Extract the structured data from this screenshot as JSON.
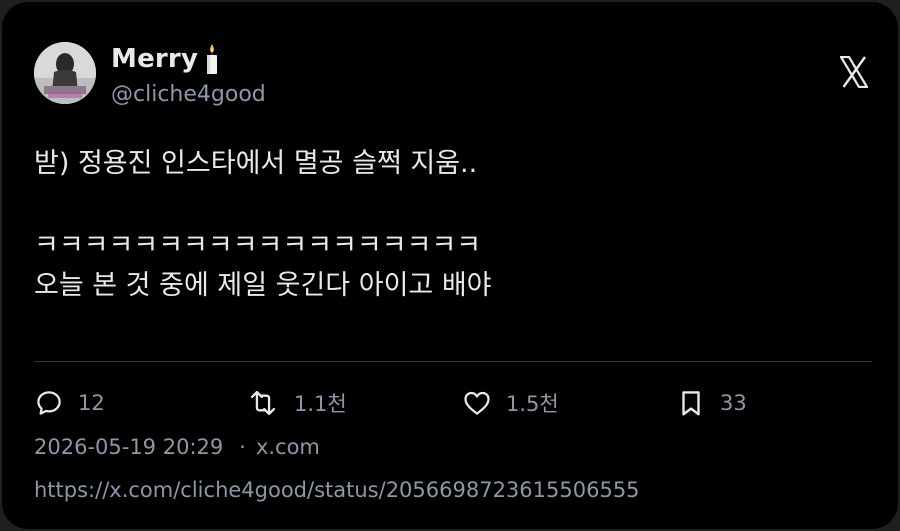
{
  "author": {
    "display_name": "Merry",
    "handle": "@cliche4good",
    "name_emoji": "candle-icon"
  },
  "tweet": {
    "lines": [
      "받) 정용진 인스타에서 멸공 슬쩍 지움..",
      "",
      "ㅋㅋㅋㅋㅋㅋㅋㅋㅋㅋㅋㅋㅋㅋㅋㅋㅋㅋ",
      "오늘 본 것 중에 제일 웃긴다 아이고 배야"
    ]
  },
  "stats": {
    "replies": "12",
    "retweets": "1.1천",
    "likes": "1.5천",
    "bookmarks": "33"
  },
  "meta": {
    "datetime": "2026-05-19 20:29",
    "separator": "·",
    "source": "x.com",
    "url": "https://x.com/cliche4good/status/2056698723615506555"
  },
  "colors": {
    "background": "#000000",
    "text": "#e7e9ea",
    "secondary": "#8b98a5",
    "divider": "#2f3336"
  }
}
